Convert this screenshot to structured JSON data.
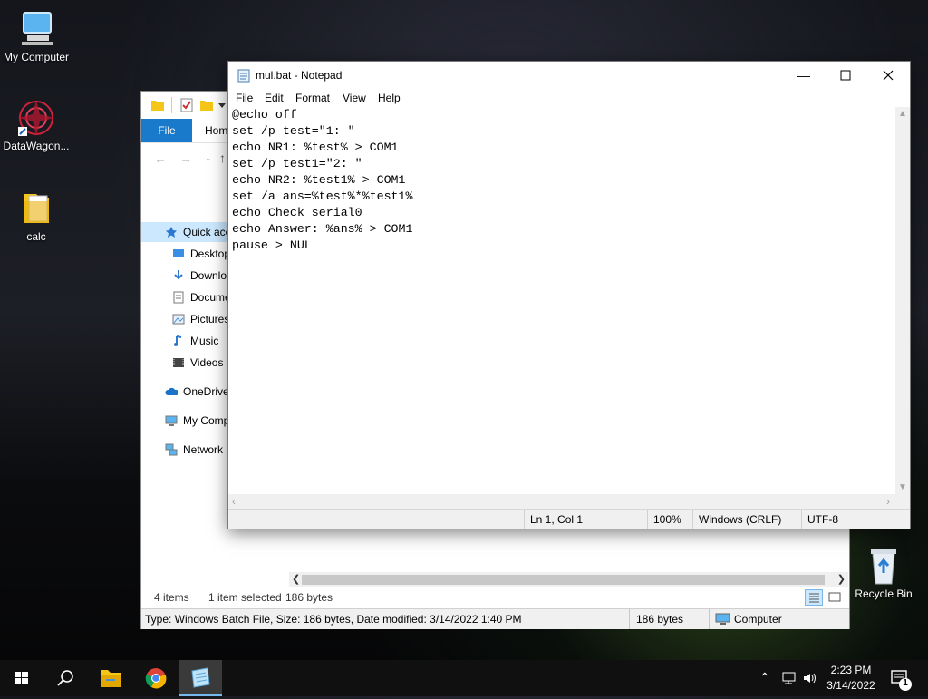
{
  "desktop": {
    "icons": [
      {
        "label": "My Computer"
      },
      {
        "label": "DataWagon..."
      },
      {
        "label": "calc"
      },
      {
        "label": "Recycle Bin"
      }
    ]
  },
  "explorer": {
    "ribbon": {
      "file_tab": "File",
      "home_tab": "Home"
    },
    "nav": {
      "quick_access": "Quick access",
      "desktop": "Desktop",
      "downloads": "Downloads",
      "documents": "Documents",
      "pictures": "Pictures",
      "music": "Music",
      "videos": "Videos",
      "onedrive": "OneDrive",
      "my_computer": "My Computer",
      "network": "Network"
    },
    "status": {
      "items": "4 items",
      "selected": "1 item selected",
      "size": "186 bytes"
    },
    "details": {
      "info": "Type: Windows Batch File, Size: 186 bytes, Date modified: 3/14/2022 1:40 PM",
      "size": "186 bytes",
      "location": "Computer"
    }
  },
  "notepad": {
    "title": "mul.bat - Notepad",
    "menu": {
      "file": "File",
      "edit": "Edit",
      "format": "Format",
      "view": "View",
      "help": "Help"
    },
    "content": "@echo off\nset /p test=\"1: \"\necho NR1: %test% > COM1\nset /p test1=\"2: \"\necho NR2: %test1% > COM1\nset /a ans=%test%*%test1%\necho Check serial0\necho Answer: %ans% > COM1\npause > NUL",
    "status": {
      "position": "Ln 1, Col 1",
      "zoom": "100%",
      "line_ending": "Windows (CRLF)",
      "encoding": "UTF-8"
    }
  },
  "taskbar": {
    "time": "2:23 PM",
    "date": "3/14/2022",
    "notification_count": "1"
  },
  "colors": {
    "accent": "#1979ca",
    "selection": "#cce8ff",
    "taskbar": "#101010"
  }
}
